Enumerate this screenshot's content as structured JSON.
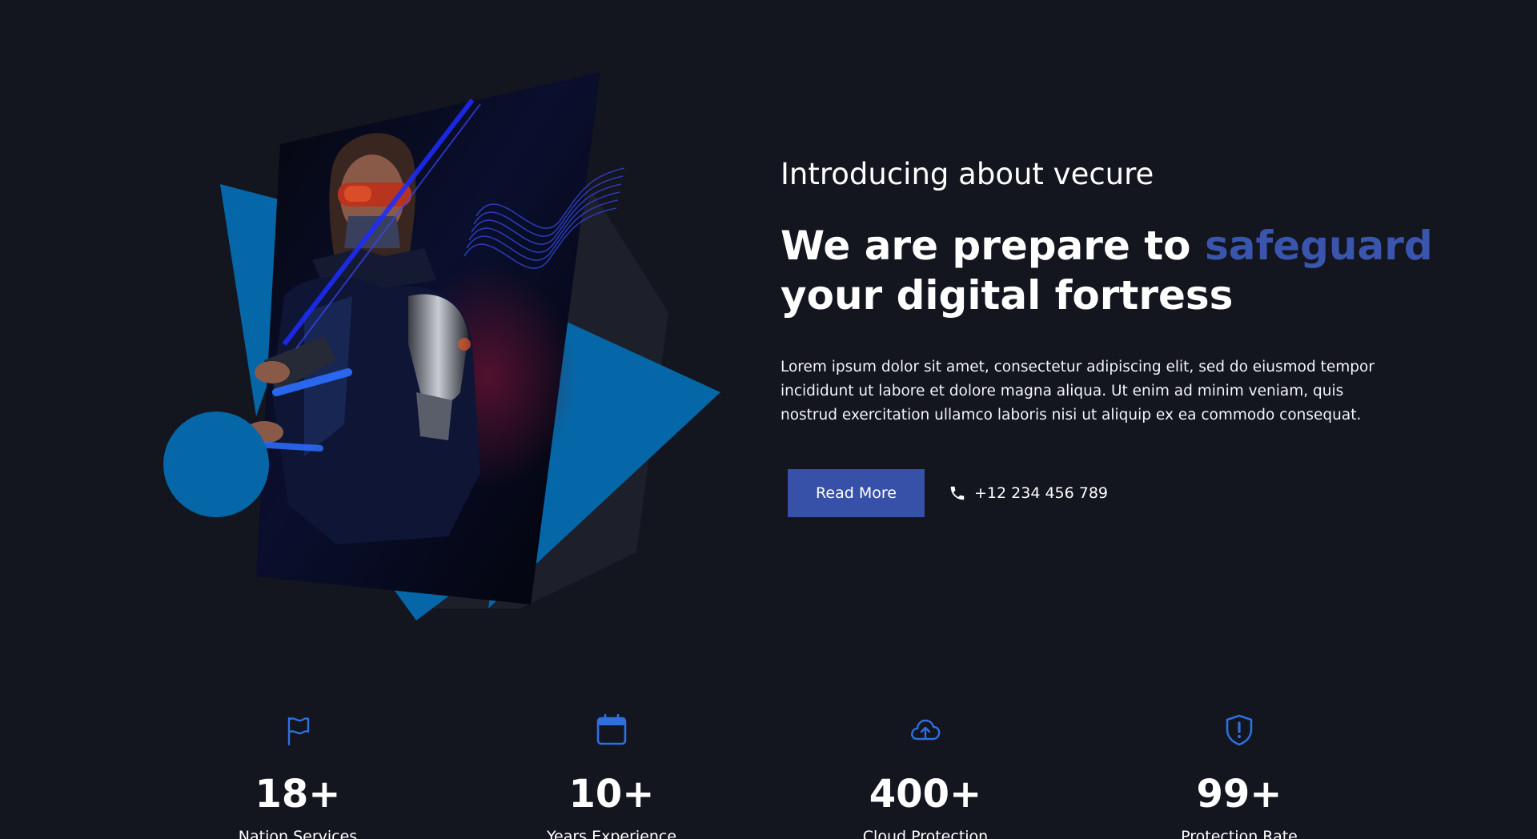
{
  "about": {
    "eyebrow": "Introducing about vecure",
    "title_before": "We are prepare to ",
    "title_accent": "safeguard",
    "title_after": " your digital fortress",
    "text": "Lorem ipsum dolor sit amet, consectetur adipiscing elit, sed do eiusmod tempor incididunt ut labore et dolore magna aliqua. Ut enim ad minim veniam, quis nostrud exercitation ullamco laboris nisi ut aliquip ex ea commodo consequat.",
    "read_more_label": "Read More",
    "phone": "+12 234 456 789"
  },
  "stats": [
    {
      "icon": "flag-icon",
      "value": "18+",
      "label": "Nation Services"
    },
    {
      "icon": "calendar-icon",
      "value": "10+",
      "label": "Years Experience"
    },
    {
      "icon": "cloud-upload-icon",
      "value": "400+",
      "label": "Cloud Protection"
    },
    {
      "icon": "shield-alert-icon",
      "value": "99+",
      "label": "Protection Rate"
    }
  ],
  "colors": {
    "background": "#13151f",
    "accent": "#3a55ad",
    "button": "#3651a7",
    "shape_blue": "#0567a7",
    "icon_blue": "#2f6fe0"
  }
}
